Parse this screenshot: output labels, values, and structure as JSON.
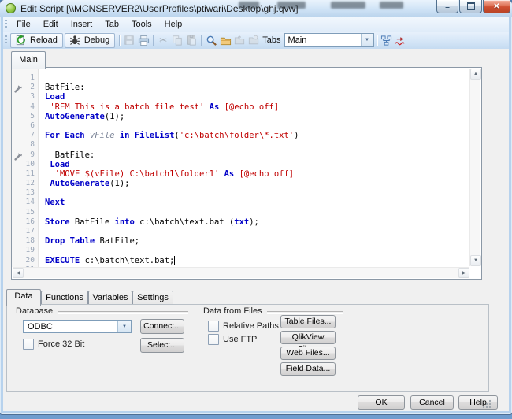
{
  "window": {
    "title": "Edit Script [\\\\MCNSERVER2\\UserProfiles\\ptiwari\\Desktop\\ghj.qvw]",
    "controls": {
      "minimize": "–",
      "close": "✕"
    }
  },
  "menu": {
    "items": [
      "File",
      "Edit",
      "Insert",
      "Tab",
      "Tools",
      "Help"
    ]
  },
  "toolbar": {
    "reload_label": "Reload",
    "debug_label": "Debug",
    "tabs_label": "Tabs",
    "tab_selector_value": "Main",
    "icons": [
      "reload-icon",
      "debug-icon",
      "save-icon",
      "print-icon",
      "cut-icon",
      "copy-icon",
      "paste-icon",
      "find-icon",
      "open-folder-icon",
      "import-file-icon",
      "import-web-icon",
      "table-viewer-icon",
      "syntax-check-icon"
    ]
  },
  "script_tab": {
    "label": "Main"
  },
  "editor": {
    "lines": [
      {
        "segs": []
      },
      {
        "marker": true,
        "segs": [
          {
            "c": "p",
            "t": "BatFile:"
          }
        ]
      },
      {
        "segs": [
          {
            "c": "k",
            "t": "Load"
          }
        ]
      },
      {
        "segs": [
          {
            "c": "p",
            "t": " "
          },
          {
            "c": "s",
            "t": "'REM This is a batch file test'"
          },
          {
            "c": "p",
            "t": " "
          },
          {
            "c": "k",
            "t": "As"
          },
          {
            "c": "p",
            "t": " "
          },
          {
            "c": "s",
            "t": "[@echo off]"
          }
        ]
      },
      {
        "segs": [
          {
            "c": "k",
            "t": "AutoGenerate"
          },
          {
            "c": "p",
            "t": "(1);"
          }
        ]
      },
      {
        "segs": []
      },
      {
        "segs": [
          {
            "c": "k",
            "t": "For Each"
          },
          {
            "c": "p",
            "t": " "
          },
          {
            "c": "v",
            "t": "vFile"
          },
          {
            "c": "p",
            "t": " "
          },
          {
            "c": "k",
            "t": "in"
          },
          {
            "c": "p",
            "t": " "
          },
          {
            "c": "k",
            "t": "FileList"
          },
          {
            "c": "p",
            "t": "("
          },
          {
            "c": "s",
            "t": "'c:\\batch\\folder\\*.txt'"
          },
          {
            "c": "p",
            "t": ")"
          }
        ]
      },
      {
        "segs": []
      },
      {
        "marker": true,
        "segs": [
          {
            "c": "p",
            "t": "  BatFile:"
          }
        ]
      },
      {
        "segs": [
          {
            "c": "p",
            "t": " "
          },
          {
            "c": "k",
            "t": "Load"
          }
        ]
      },
      {
        "segs": [
          {
            "c": "p",
            "t": "  "
          },
          {
            "c": "s",
            "t": "'MOVE $(vFile) C:\\batch1\\folder1'"
          },
          {
            "c": "p",
            "t": " "
          },
          {
            "c": "k",
            "t": "As"
          },
          {
            "c": "p",
            "t": " "
          },
          {
            "c": "s",
            "t": "[@echo off]"
          }
        ]
      },
      {
        "segs": [
          {
            "c": "p",
            "t": " "
          },
          {
            "c": "k",
            "t": "AutoGenerate"
          },
          {
            "c": "p",
            "t": "(1);"
          }
        ]
      },
      {
        "segs": []
      },
      {
        "segs": [
          {
            "c": "k",
            "t": "Next"
          }
        ]
      },
      {
        "segs": []
      },
      {
        "segs": [
          {
            "c": "k",
            "t": "Store"
          },
          {
            "c": "p",
            "t": " BatFile "
          },
          {
            "c": "k",
            "t": "into"
          },
          {
            "c": "p",
            "t": " c:\\batch\\text.bat ("
          },
          {
            "c": "k",
            "t": "txt"
          },
          {
            "c": "p",
            "t": ");"
          }
        ]
      },
      {
        "segs": []
      },
      {
        "segs": [
          {
            "c": "k",
            "t": "Drop Table"
          },
          {
            "c": "p",
            "t": " BatFile;"
          }
        ]
      },
      {
        "segs": []
      },
      {
        "caret": true,
        "segs": [
          {
            "c": "k",
            "t": "EXECUTE"
          },
          {
            "c": "p",
            "t": " c:\\batch\\text.bat;"
          }
        ]
      },
      {
        "segs": []
      }
    ]
  },
  "bottom_tabs": {
    "tabs": [
      "Data",
      "Functions",
      "Variables",
      "Settings"
    ],
    "active": "Data"
  },
  "data_tab": {
    "database": {
      "group_label": "Database",
      "combo_value": "ODBC",
      "connect_label": "Connect...",
      "select_label": "Select...",
      "force32_label": "Force 32 Bit",
      "force32_checked": false
    },
    "files": {
      "group_label": "Data from Files",
      "relative_paths_label": "Relative Paths",
      "relative_paths_checked": false,
      "use_ftp_label": "Use FTP",
      "use_ftp_checked": false,
      "buttons": [
        "Table Files...",
        "QlikView File...",
        "Web Files...",
        "Field Data..."
      ]
    }
  },
  "footer": {
    "ok": "OK",
    "cancel": "Cancel",
    "help": "Help"
  },
  "colors": {
    "keyword_blue": "#0000c8",
    "string_red": "#c00000",
    "variable_gray": "#7b8497",
    "titlebar_blue": "#cfe3f6",
    "close_red": "#cf4f31",
    "dialog_gray": "#f0f0f0"
  }
}
